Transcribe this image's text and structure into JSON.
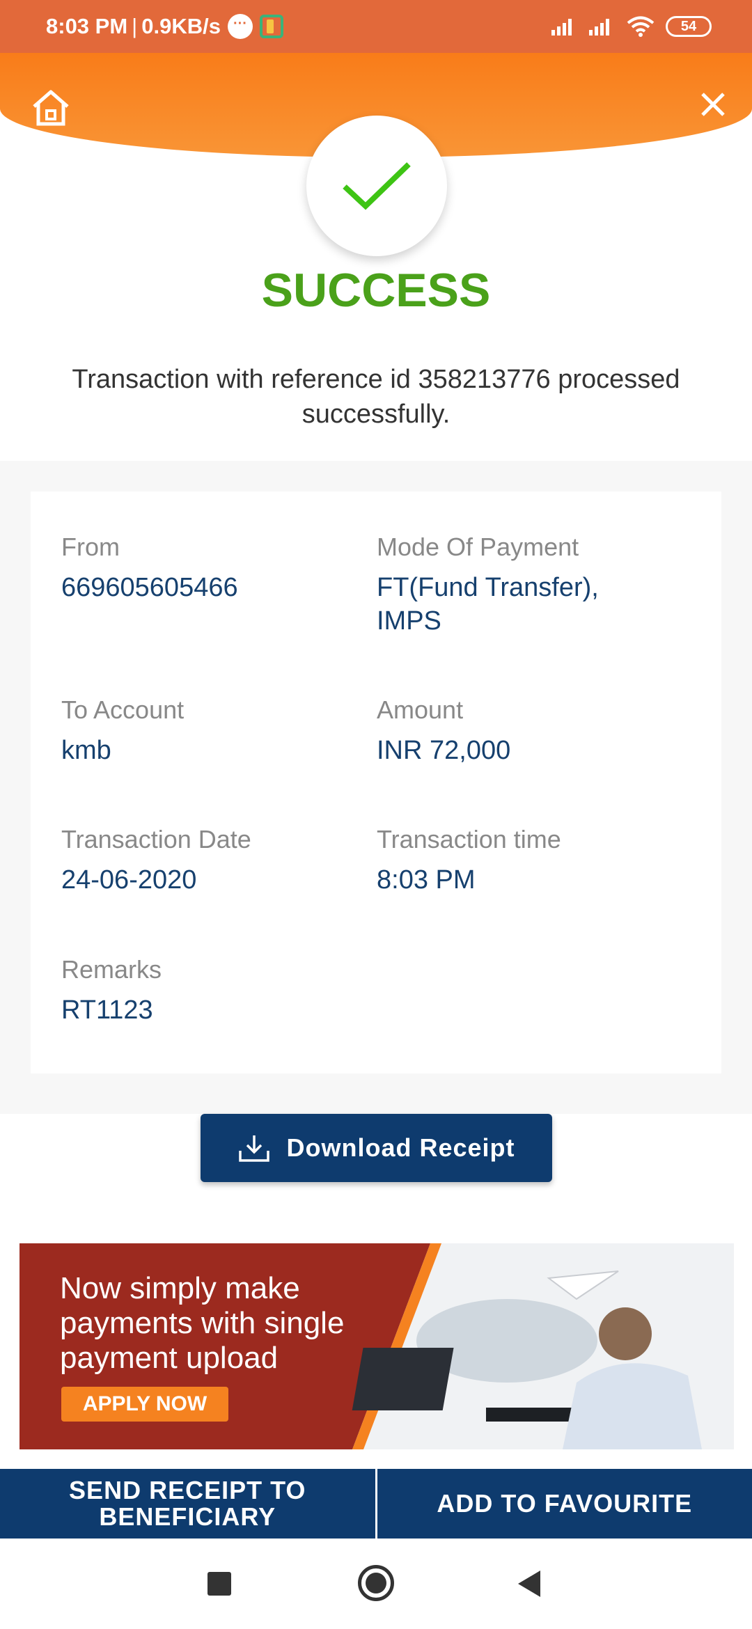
{
  "status_bar": {
    "time": "8:03 PM",
    "separator": "|",
    "speed": "0.9KB/s",
    "chat_glyph": "···",
    "battery": "54"
  },
  "header": {
    "home_icon": "home-icon",
    "close_icon": "close-icon",
    "check_icon": "check-icon",
    "brand_color": "#f97c19"
  },
  "result": {
    "title": "SUCCESS",
    "title_color": "#4aa11a",
    "message": "Transaction with reference id 358213776 processed successfully."
  },
  "details": {
    "from": {
      "label": "From",
      "value": "669605605466"
    },
    "mode": {
      "label": "Mode Of Payment",
      "value_line1": "FT(Fund Transfer),",
      "value_line2": "IMPS"
    },
    "to_account": {
      "label": "To Account",
      "value": "kmb"
    },
    "amount": {
      "label": "Amount",
      "value": "INR 72,000"
    },
    "date": {
      "label": "Transaction Date",
      "value": "24-06-2020"
    },
    "time": {
      "label": "Transaction time",
      "value": "8:03 PM"
    },
    "remarks": {
      "label": "Remarks",
      "value": "RT1123"
    }
  },
  "download": {
    "label": "Download Receipt",
    "icon": "download-icon"
  },
  "banner": {
    "line1": "Now simply make",
    "line2": "payments with single",
    "line3": "payment upload",
    "cta": "APPLY NOW"
  },
  "bottom_actions": {
    "send_line1": "SEND RECEIPT TO",
    "send_line2": "BENEFICIARY",
    "favourite": "ADD TO FAVOURITE"
  },
  "colors": {
    "navy": "#0e3b6e",
    "value_text": "#16406e",
    "status_bar": "#e2693a"
  }
}
